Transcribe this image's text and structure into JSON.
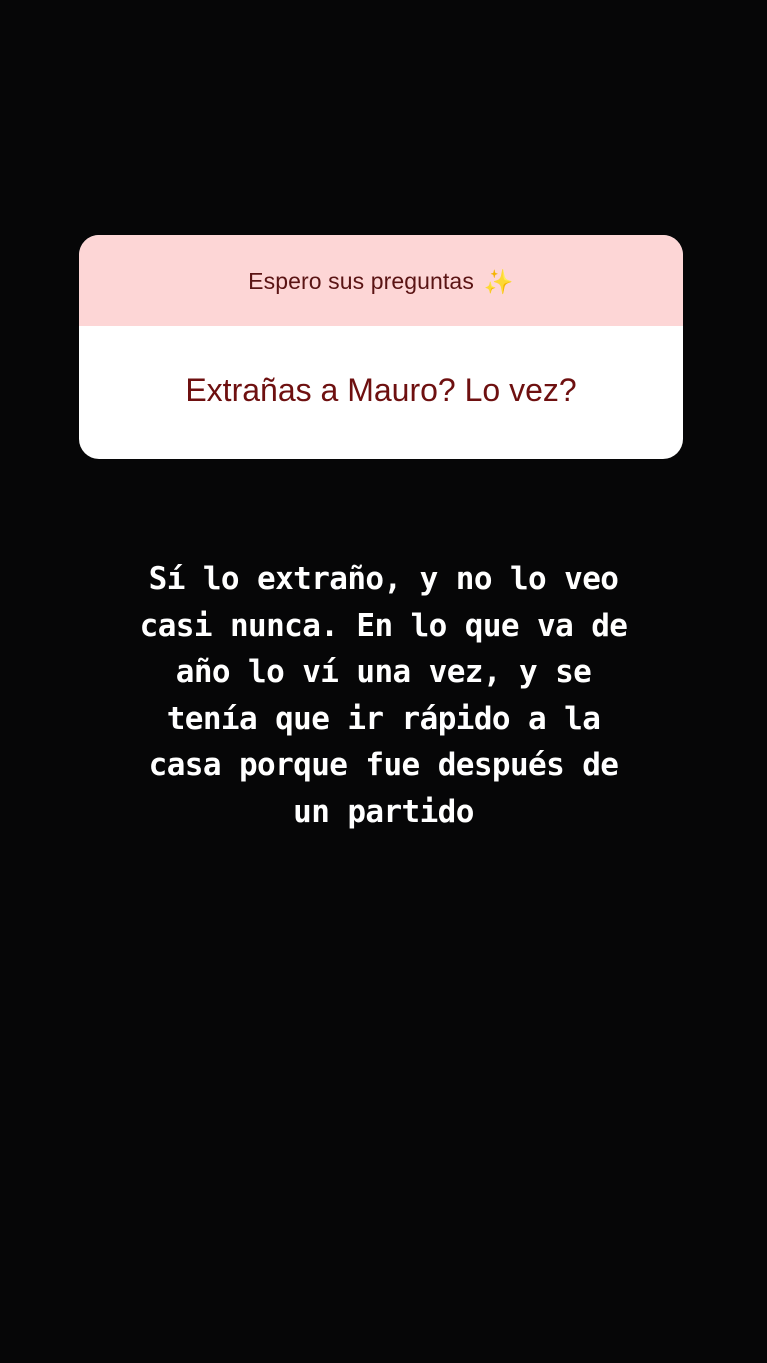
{
  "question_sticker": {
    "prompt": "Espero sus preguntas",
    "prompt_icon": "✨",
    "question": "Extrañas a Mauro? Lo vez?"
  },
  "answer_text": "Sí lo extraño, y no lo veo\ncasi nunca. En lo que va de\naño lo ví una vez, y se\ntenía que ir rápido a la\ncasa porque fue después de\nun partido",
  "colors": {
    "background": "#060607",
    "sticker_header": "#fdd6d6",
    "sticker_body": "#ffffff",
    "prompt_text": "#5a1414",
    "question_text": "#6e1010",
    "answer_text": "#ffffff"
  }
}
